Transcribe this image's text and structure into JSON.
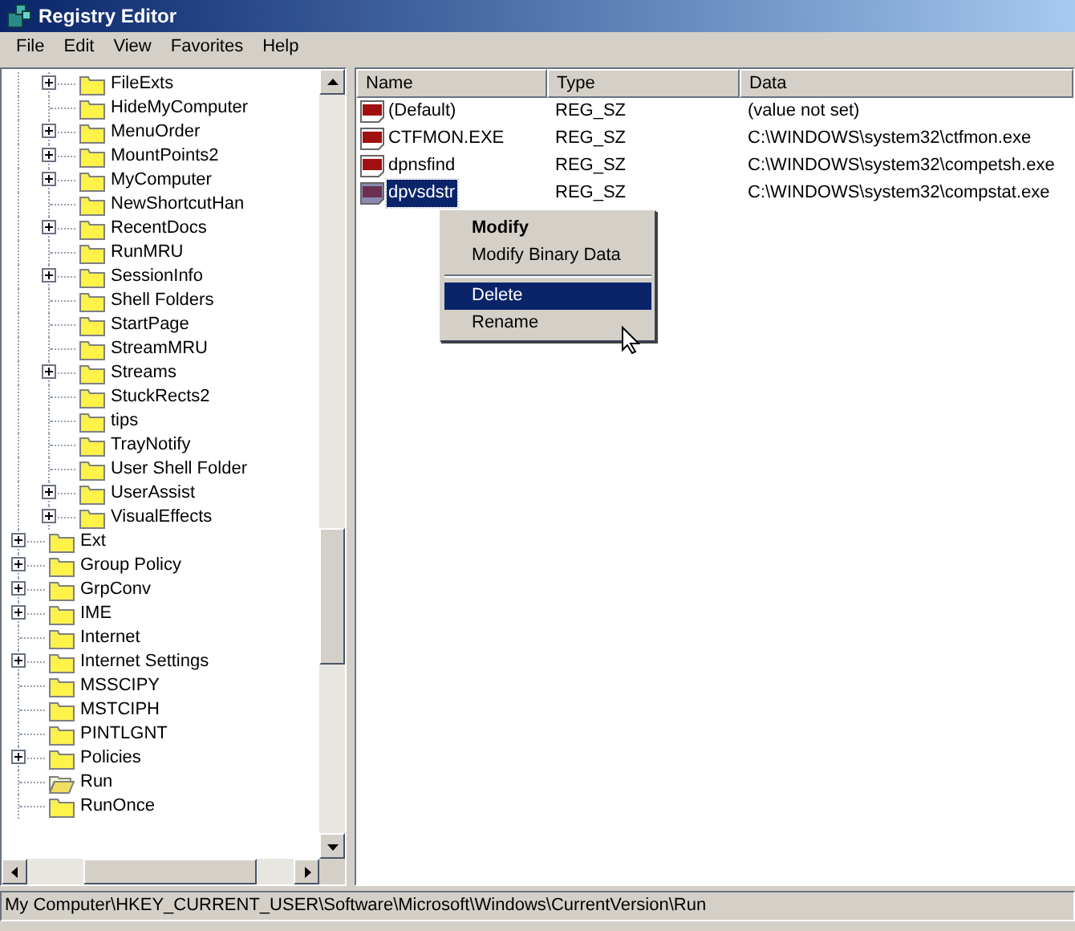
{
  "window": {
    "title": "Registry Editor"
  },
  "menu_bar": [
    "File",
    "Edit",
    "View",
    "Favorites",
    "Help"
  ],
  "tree": [
    {
      "children": [
        {
          "label": "FileExts",
          "expandable": true,
          "selected": false
        },
        {
          "label": "HideMyComputer",
          "expandable": false,
          "selected": false
        },
        {
          "label": "MenuOrder",
          "expandable": true,
          "selected": false
        },
        {
          "label": "MountPoints2",
          "expandable": true,
          "selected": false
        },
        {
          "label": "MyComputer",
          "expandable": true,
          "selected": false
        },
        {
          "label": "NewShortcutHan",
          "expandable": false,
          "selected": false
        },
        {
          "label": "RecentDocs",
          "expandable": true,
          "selected": false
        },
        {
          "label": "RunMRU",
          "expandable": false,
          "selected": false
        },
        {
          "label": "SessionInfo",
          "expandable": true,
          "selected": false
        },
        {
          "label": "Shell Folders",
          "expandable": false,
          "selected": false
        },
        {
          "label": "StartPage",
          "expandable": false,
          "selected": false
        },
        {
          "label": "StreamMRU",
          "expandable": false,
          "selected": false
        },
        {
          "label": "Streams",
          "expandable": true,
          "selected": false
        },
        {
          "label": "StuckRects2",
          "expandable": false,
          "selected": false
        },
        {
          "label": "tips",
          "expandable": false,
          "selected": false
        },
        {
          "label": "TrayNotify",
          "expandable": false,
          "selected": false
        },
        {
          "label": "User Shell Folder",
          "expandable": false,
          "selected": false
        },
        {
          "label": "UserAssist",
          "expandable": true,
          "selected": false
        },
        {
          "label": "VisualEffects",
          "expandable": true,
          "selected": false
        }
      ]
    },
    {
      "label": "Ext",
      "expandable": true,
      "selected": false
    },
    {
      "label": "Group Policy",
      "expandable": true,
      "selected": false
    },
    {
      "label": "GrpConv",
      "expandable": true,
      "selected": false
    },
    {
      "label": "IME",
      "expandable": true,
      "selected": false
    },
    {
      "label": "Internet",
      "expandable": false,
      "selected": false
    },
    {
      "label": "Internet Settings",
      "expandable": true,
      "selected": false
    },
    {
      "label": "MSSCIPY",
      "expandable": false,
      "selected": false
    },
    {
      "label": "MSTCIPH",
      "expandable": false,
      "selected": false
    },
    {
      "label": "PINTLGNT",
      "expandable": false,
      "selected": false
    },
    {
      "label": "Policies",
      "expandable": true,
      "selected": false
    },
    {
      "label": "Run",
      "expandable": false,
      "selected": true
    },
    {
      "label": "RunOnce",
      "expandable": false,
      "selected": false
    }
  ],
  "table": {
    "columns": [
      "Name",
      "Type",
      "Data"
    ],
    "rows": [
      {
        "name": "(Default)",
        "type": "REG_SZ",
        "data": "(value not set)",
        "selected": false
      },
      {
        "name": "CTFMON.EXE",
        "type": "REG_SZ",
        "data": "C:\\WINDOWS\\system32\\ctfmon.exe",
        "selected": false
      },
      {
        "name": "dpnsfind",
        "type": "REG_SZ",
        "data": "C:\\WINDOWS\\system32\\competsh.exe",
        "selected": false
      },
      {
        "name": "dpvsdstr",
        "type": "REG_SZ",
        "data": "C:\\WINDOWS\\system32\\compstat.exe",
        "selected": true
      }
    ]
  },
  "context_menu": [
    {
      "kind": "item",
      "label": "Modify",
      "default": true,
      "selected": false
    },
    {
      "kind": "item",
      "label": "Modify Binary Data",
      "default": false,
      "selected": false
    },
    {
      "kind": "separator"
    },
    {
      "kind": "item",
      "label": "Delete",
      "default": false,
      "selected": true
    },
    {
      "kind": "item",
      "label": "Rename",
      "default": false,
      "selected": false
    }
  ],
  "status_bar": "My Computer\\HKEY_CURRENT_USER\\Software\\Microsoft\\Windows\\CurrentVersion\\Run"
}
